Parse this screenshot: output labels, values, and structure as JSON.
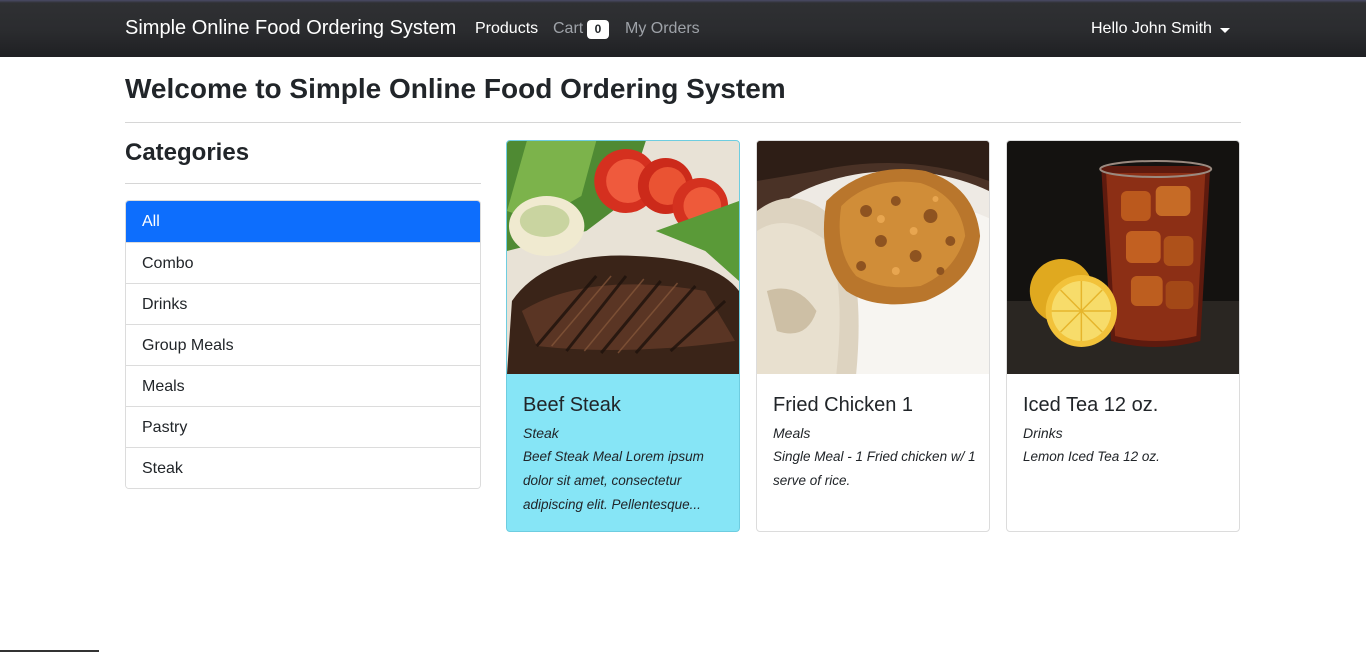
{
  "navbar": {
    "brand": "Simple Online Food Ordering System",
    "products": "Products",
    "cart": "Cart",
    "cart_count": "0",
    "orders": "My Orders",
    "user": "Hello John Smith"
  },
  "page": {
    "title": "Welcome to Simple Online Food Ordering System"
  },
  "categories": {
    "title": "Categories",
    "items": [
      "All",
      "Combo",
      "Drinks",
      "Group Meals",
      "Meals",
      "Pastry",
      "Steak"
    ],
    "active": "All"
  },
  "products": [
    {
      "name": "Beef Steak",
      "category": "Steak",
      "description": "Beef Steak Meal Lorem ipsum dolor sit amet, consectetur adipiscing elit. Pellentesque...",
      "image": "beef-steak-photo"
    },
    {
      "name": "Fried Chicken 1",
      "category": "Meals",
      "description": "Single Meal - 1 Fried chicken w/ 1 serve of rice.",
      "image": "fried-chicken-photo"
    },
    {
      "name": "Iced Tea 12 oz.",
      "category": "Drinks",
      "description": "Lemon Iced Tea 12 oz.",
      "image": "iced-tea-photo"
    }
  ],
  "colors": {
    "navbar": "#2b2c2f",
    "active_category": "#0d6efd",
    "highlight_card": "#86e5f6"
  }
}
